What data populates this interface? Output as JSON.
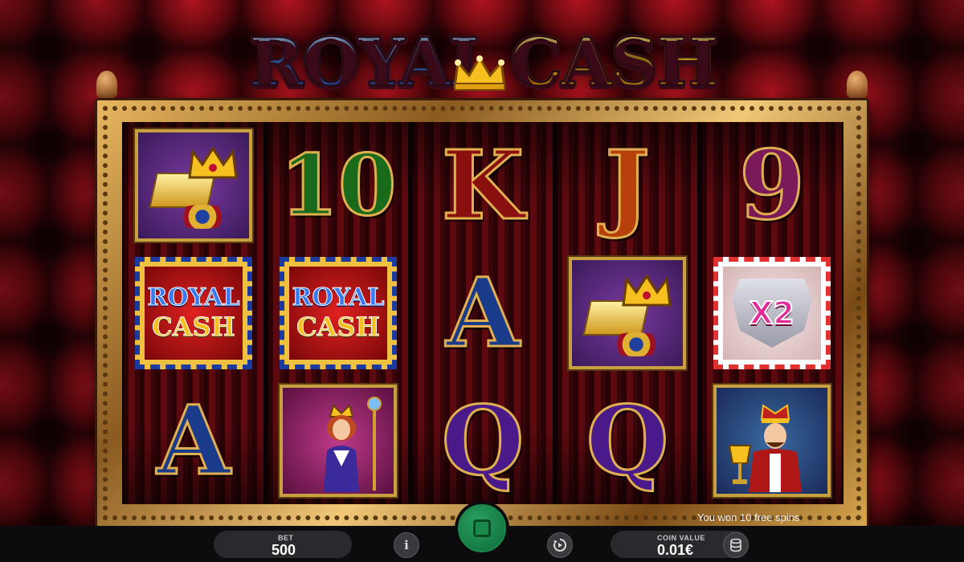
{
  "game": {
    "logo_word_1": "ROYAL",
    "logo_word_2": "CASH"
  },
  "reels": [
    [
      "treasure",
      "wild",
      "A"
    ],
    [
      "10",
      "wild",
      "queen"
    ],
    [
      "K",
      "A",
      "Q"
    ],
    [
      "J",
      "treasure",
      "Q"
    ],
    [
      "9",
      "multiplier",
      "king"
    ]
  ],
  "symbols": {
    "ten": "10",
    "king_letter": "K",
    "jack_letter": "J",
    "nine": "9",
    "ace": "A",
    "queen_letter": "Q",
    "wild_line_1": "ROYAL",
    "wild_line_2": "CASH",
    "multiplier": "X2"
  },
  "message": "You won 10 free spins",
  "controls": {
    "bet_label": "BET",
    "bet_value": "500",
    "coin_value_label": "COIN VALUE",
    "coin_value": "0.01€",
    "info_icon": "info-icon",
    "autoplay_icon": "autoplay-icon",
    "spin_icon": "stop-icon",
    "coins_icon": "coins-icon"
  },
  "colors": {
    "spin_button": "#1a8a4a",
    "frame_gold": "#d8a850",
    "background_velvet": "#8a0e18"
  }
}
